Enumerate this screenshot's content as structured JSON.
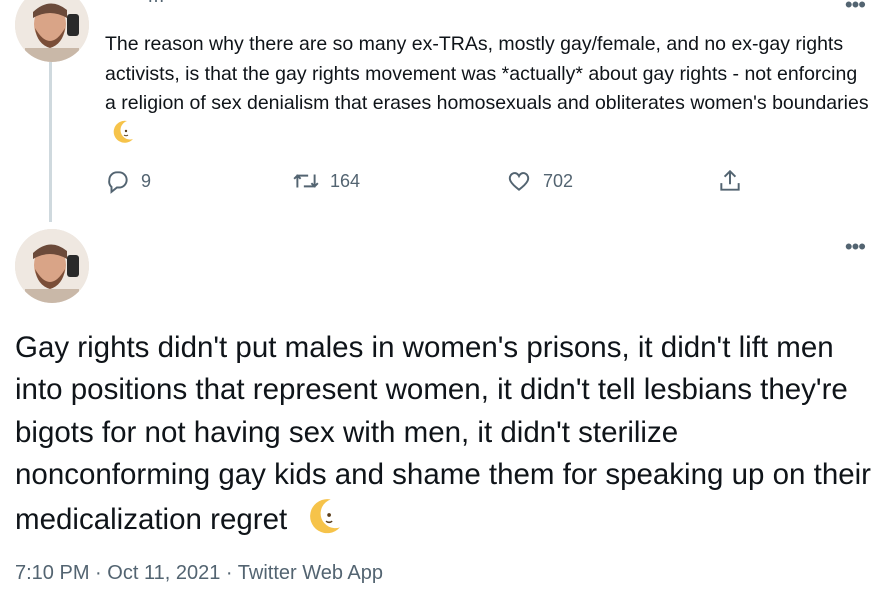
{
  "parent_tweet": {
    "header_fragment": "· · ·   …",
    "text": "The reason why there are so many ex-TRAs, mostly gay/female, and no ex-gay rights activists, is that the gay rights movement was *actually* about gay rights - not enforcing a religion of sex denialism that erases homosexuals and obliterates women's boundaries",
    "actions": {
      "replies": "9",
      "retweets": "164",
      "likes": "702"
    }
  },
  "main_tweet": {
    "text": "Gay rights didn't put males in women's prisons, it didn't lift men into positions that represent women, it didn't tell lesbians they're bigots for not having sex with men, it didn't sterilize nonconforming gay kids and shame them for speaking up on their medicalization regret",
    "time": "7:10 PM",
    "date": "Oct 11, 2021",
    "source": "Twitter Web App",
    "separator": "·"
  },
  "more_label": "•••",
  "icons": [
    "reply-icon",
    "retweet-icon",
    "like-icon",
    "share-icon",
    "moon-emoji",
    "more-icon"
  ],
  "colors": {
    "text": "#0f1419",
    "secondary": "#536471",
    "thread_line": "#cfd9de",
    "moon": "#f6c34a"
  }
}
